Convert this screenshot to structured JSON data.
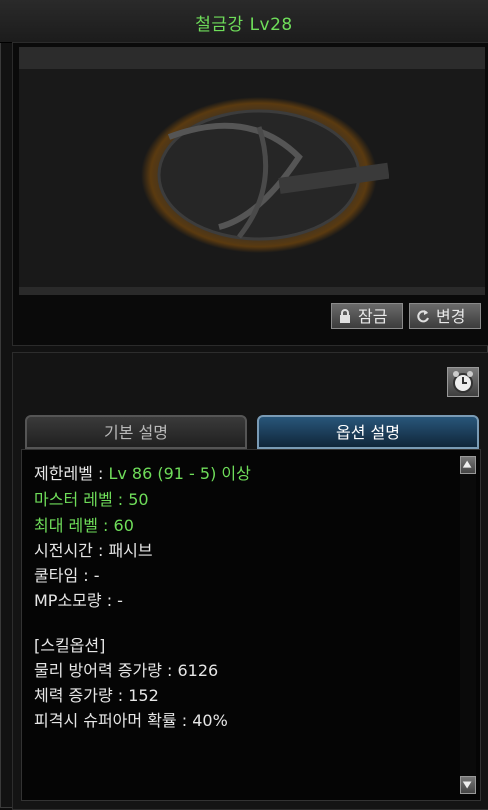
{
  "window": {
    "title": "철금강 Lv28"
  },
  "preview_buttons": {
    "lock_label": "잠금",
    "change_label": "변경"
  },
  "tabs": [
    {
      "label": "기본 설명",
      "active": false
    },
    {
      "label": "옵션 설명",
      "active": true
    }
  ],
  "description": {
    "required_level_label": "제한레벨 : ",
    "required_level_value": "Lv 86 (91 - 5) 이상",
    "master_level": "마스터 레벨 : 50",
    "max_level": "최대 레벨 : 60",
    "cast_time": "시전시간 : 패시브",
    "cooldown": "쿨타임 : -",
    "mp_cost": "MP소모량 : -",
    "skill_option_header": "[스킬옵션]",
    "options": [
      "물리 방어력 증가량 : 6126",
      "체력 증가량 : 152",
      "피격시 슈퍼아머 확률 : 40%"
    ]
  },
  "colors": {
    "accent_green": "#6fdd5a",
    "active_tab": "#28567a"
  },
  "icons": {
    "lock": "lock-icon",
    "change": "refresh-icon",
    "clock": "alarm-clock-icon",
    "scroll_up": "arrow-up-icon",
    "scroll_down": "arrow-down-icon"
  }
}
